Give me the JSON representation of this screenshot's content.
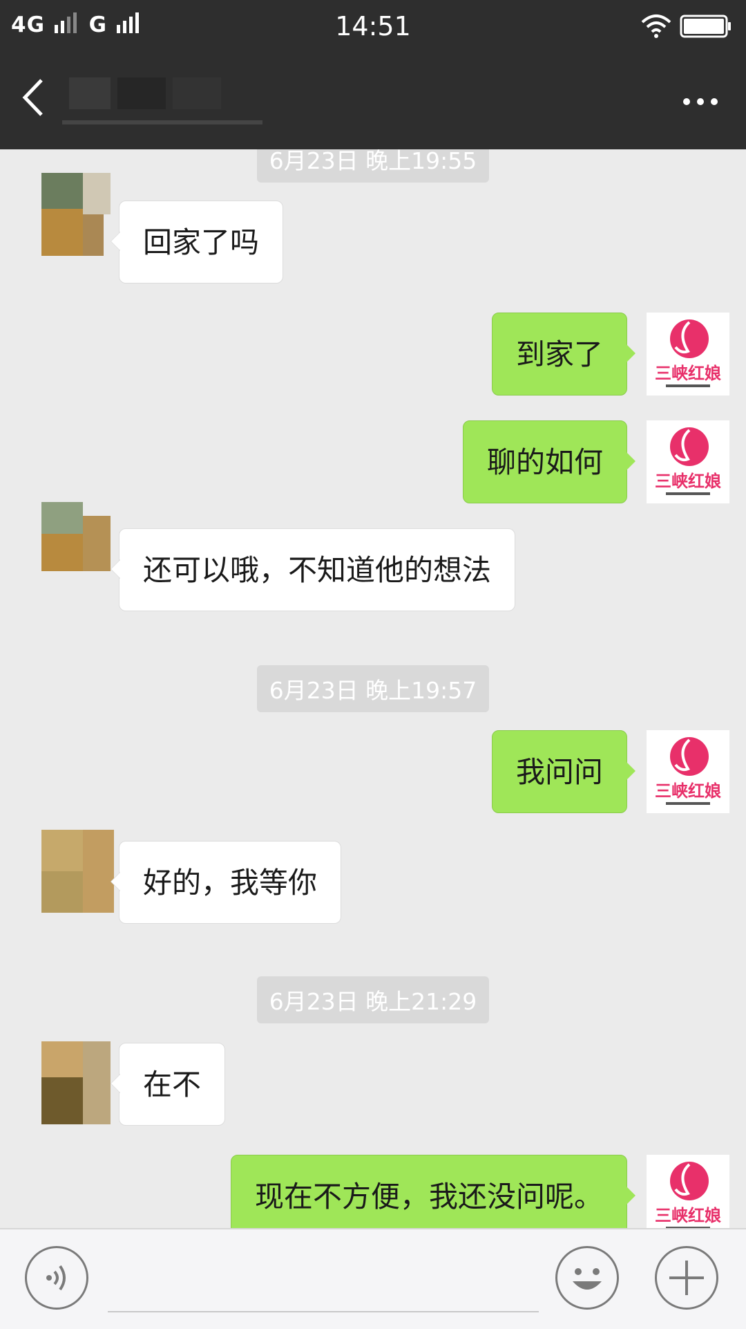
{
  "status_bar": {
    "carrier": "4G",
    "network": "G",
    "time": "14:51"
  },
  "nav": {
    "title": "",
    "back_icon": "chevron-left-icon",
    "more_icon": "ellipsis-icon"
  },
  "chat": {
    "timestamps": [
      "6月23日 晚上19:55",
      "6月23日 晚上19:57",
      "6月23日 晚上21:29"
    ],
    "messages": [
      {
        "side": "in",
        "text": "回家了吗"
      },
      {
        "side": "out",
        "text": "到家了"
      },
      {
        "side": "out",
        "text": "聊的如何"
      },
      {
        "side": "in",
        "text": "还可以哦，不知道他的想法"
      },
      {
        "side": "out",
        "text": "我问问"
      },
      {
        "side": "in",
        "text": "好的，我等你"
      },
      {
        "side": "in",
        "text": "在不"
      },
      {
        "side": "out",
        "text": "现在不方便，我还没问呢。"
      }
    ],
    "self_avatar_text": "三峡红娘"
  },
  "input_bar": {
    "voice_icon": "voice-icon",
    "emoji_icon": "emoji-icon",
    "plus_icon": "plus-icon",
    "placeholder": ""
  },
  "colors": {
    "header_bg": "#2e2e2e",
    "chat_bg": "#ebebeb",
    "outgoing_bubble": "#9fe658",
    "incoming_bubble": "#ffffff",
    "brand_pink": "#e8306a"
  }
}
